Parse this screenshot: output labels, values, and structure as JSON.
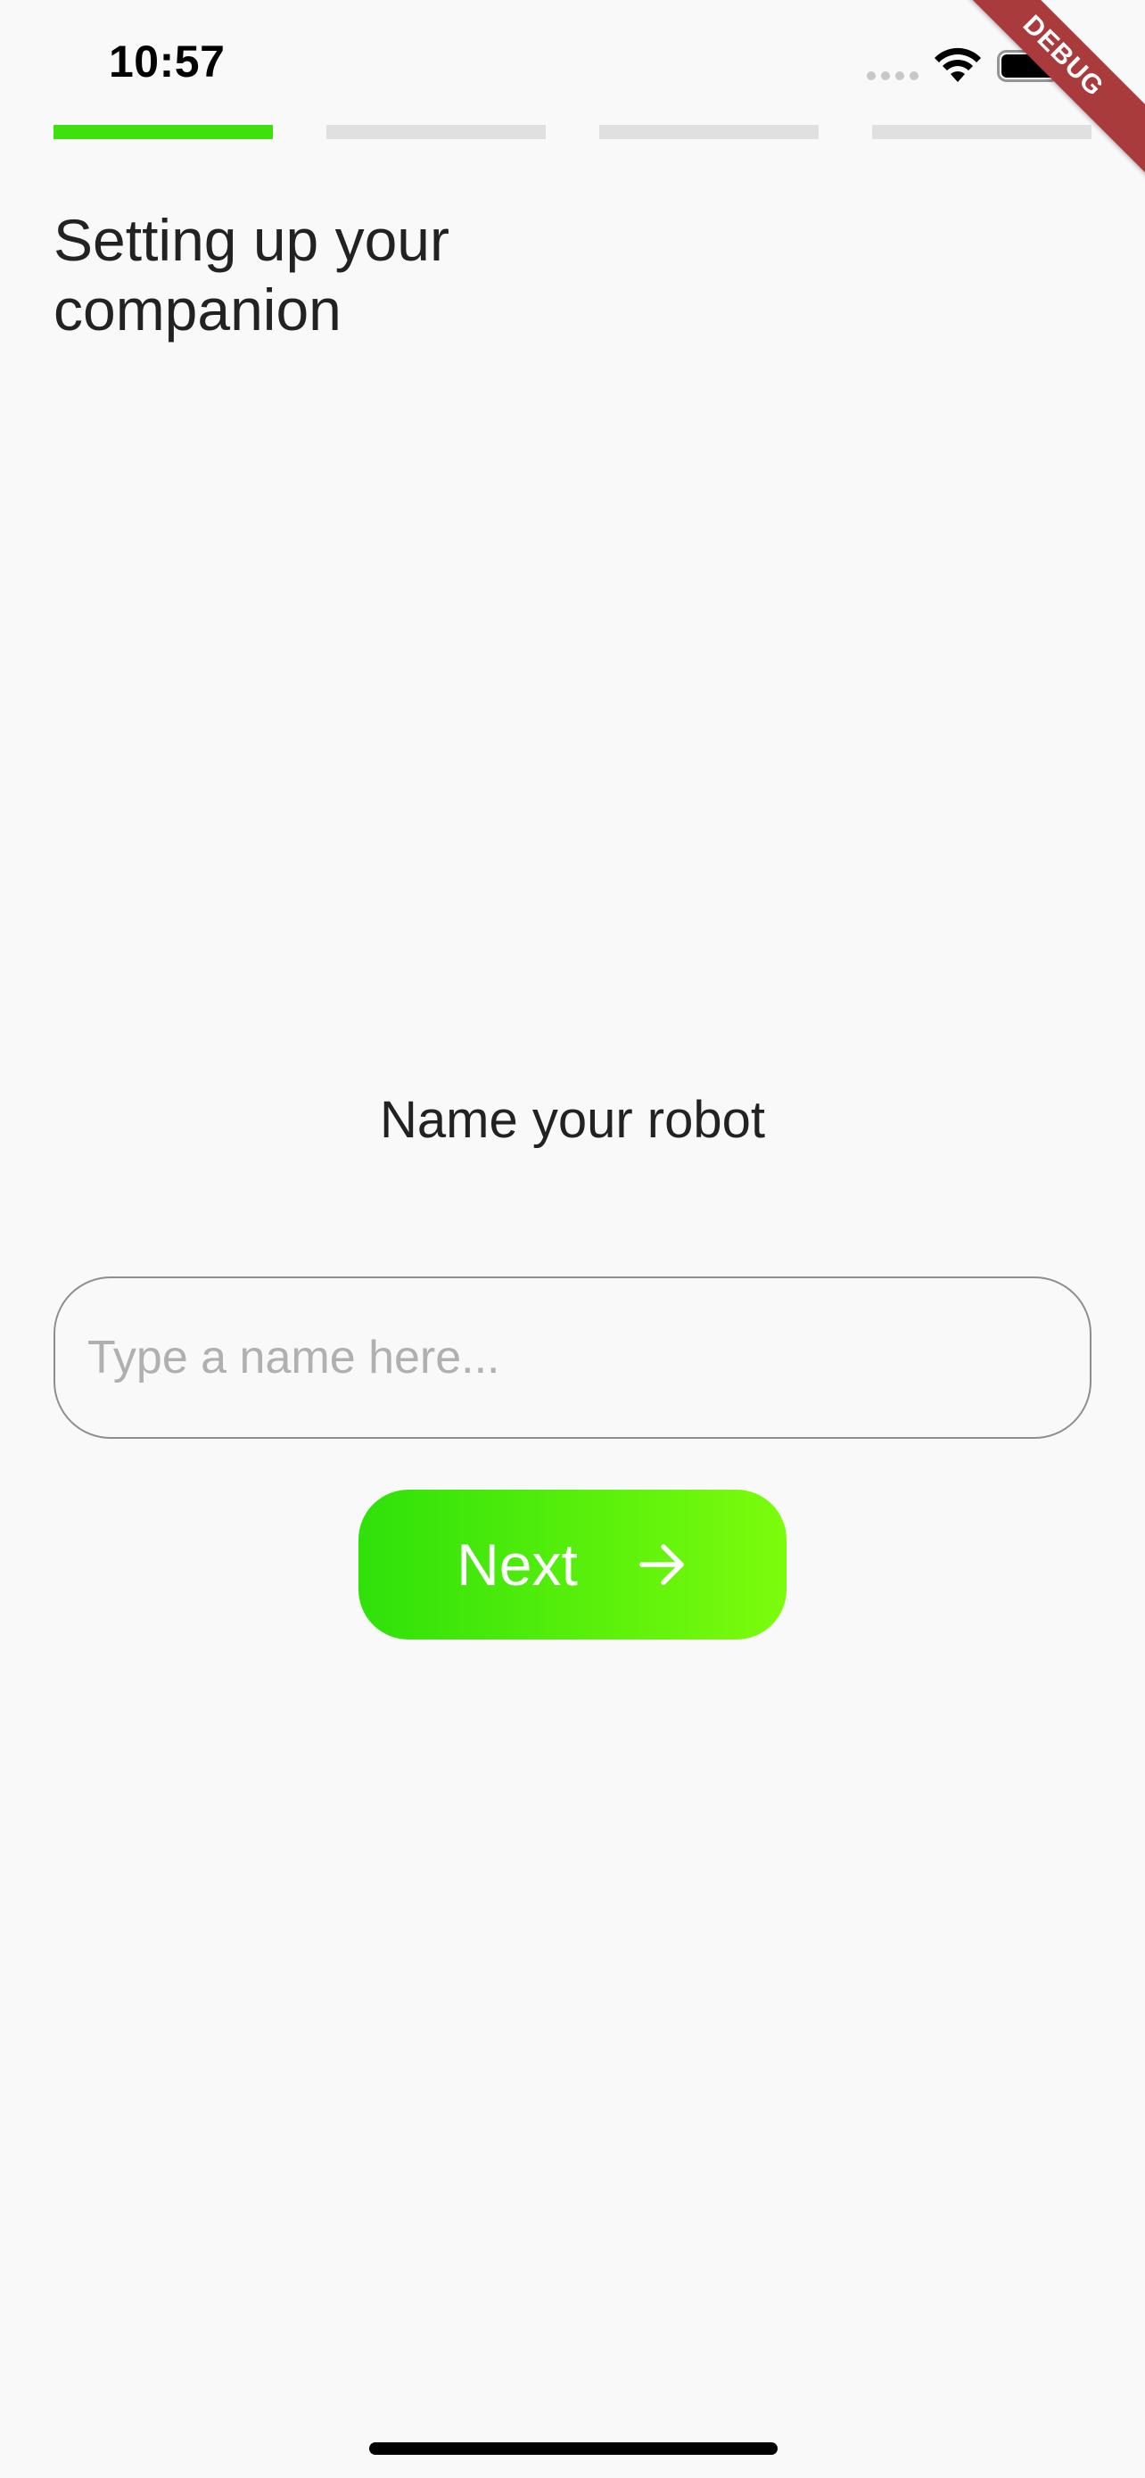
{
  "status_bar": {
    "time": "10:57",
    "icons": [
      "signal-icon",
      "wifi-icon",
      "battery-icon"
    ]
  },
  "debug_banner": {
    "label": "DEBUG",
    "color": "#a93b3c"
  },
  "progress": {
    "total_steps": 4,
    "current_step": 1,
    "active_color": "#3ee10d",
    "inactive_color": "#e0e0e0"
  },
  "header": {
    "title": "Setting up your companion"
  },
  "form": {
    "prompt": "Name your robot",
    "name_input": {
      "value": "",
      "placeholder": "Type a name here..."
    },
    "next_button": {
      "label": "Next",
      "icon": "arrow-right-icon",
      "gradient_start": "#2fe10a",
      "gradient_end": "#7cfc0c"
    }
  }
}
